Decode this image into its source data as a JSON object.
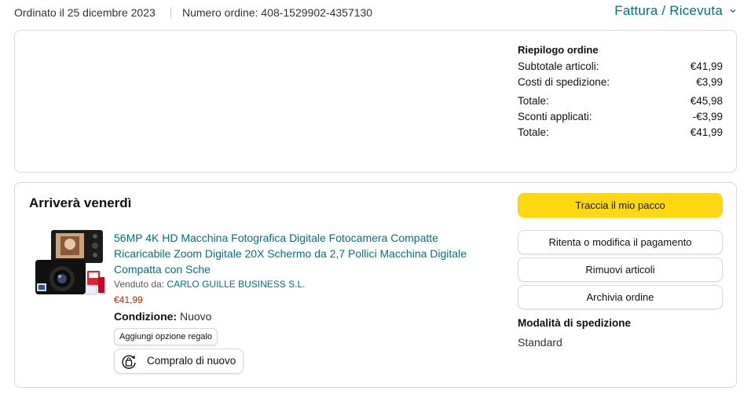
{
  "header": {
    "order_date": "Ordinato il 25 dicembre 2023",
    "order_number": "Numero ordine: 408-1529902-4357130",
    "invoice_link": "Fattura / Ricevuta",
    "invoice_icon": "chevron-down-icon"
  },
  "summary": {
    "title": "Riepilogo ordine",
    "rows": [
      {
        "label": "Subtotale articoli:",
        "value": "€41,99"
      },
      {
        "label": "Costi di spedizione:",
        "value": "€3,99"
      },
      {
        "label": "Totale:",
        "value": "€45,98"
      },
      {
        "label": "Sconti applicati:",
        "value": "-€3,99"
      },
      {
        "label": "Totale:",
        "value": "€41,99"
      }
    ]
  },
  "shipment": {
    "title": "Arriverà venerdì",
    "product": {
      "title": "56MP 4K HD Macchina Fotografica Digitale Fotocamera Compatte Ricaricabile Zoom Digitale 20X Schermo da 2,7 Pollici Macchina Digitale Compatta con Sche",
      "sold_by_label": "Venduto da:",
      "seller": "CARLO GUILLE BUSINESS S.L.",
      "price": "€41,99",
      "condition_label": "Condizione:",
      "condition_value": "Nuovo",
      "gift_button": "Aggiungi opzione regalo",
      "buy_again_button": "Compralo di nuovo",
      "buy_again_icon": "buy-again-icon"
    },
    "actions": {
      "track": "Traccia il mio pacco",
      "retry_payment": "Ritenta o modifica il pagamento",
      "remove_items": "Rimuovi articoli",
      "archive_order": "Archivia ordine"
    },
    "shipping_mode": {
      "title": "Modalità di spedizione",
      "value": "Standard"
    }
  },
  "colors": {
    "link": "#007185",
    "price": "#b12704",
    "primary_button": "#ffd814",
    "border": "#d5d9d9"
  }
}
